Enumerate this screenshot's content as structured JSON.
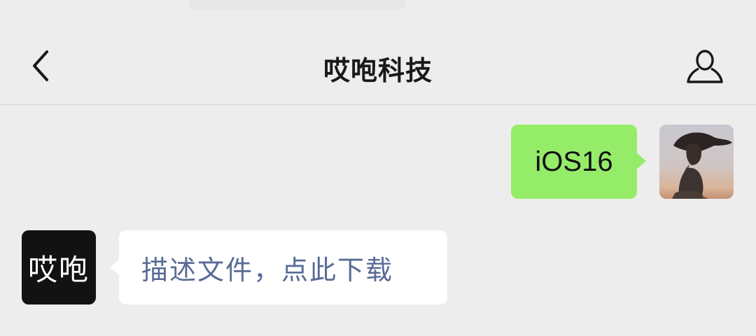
{
  "header": {
    "title": "哎咆科技",
    "back_icon": "chevron-left-icon",
    "profile_icon": "person-icon"
  },
  "messages": [
    {
      "direction": "sent",
      "text": "iOS16",
      "avatar": "user-photo-avatar",
      "bubble_color": "#95ec69"
    },
    {
      "direction": "received",
      "text": "描述文件，点此下载",
      "avatar_text": "哎咆",
      "bubble_color": "#ffffff",
      "link_color": "#576b95"
    }
  ],
  "colors": {
    "background": "#ededed",
    "avatar_bot_bg": "#121212"
  }
}
